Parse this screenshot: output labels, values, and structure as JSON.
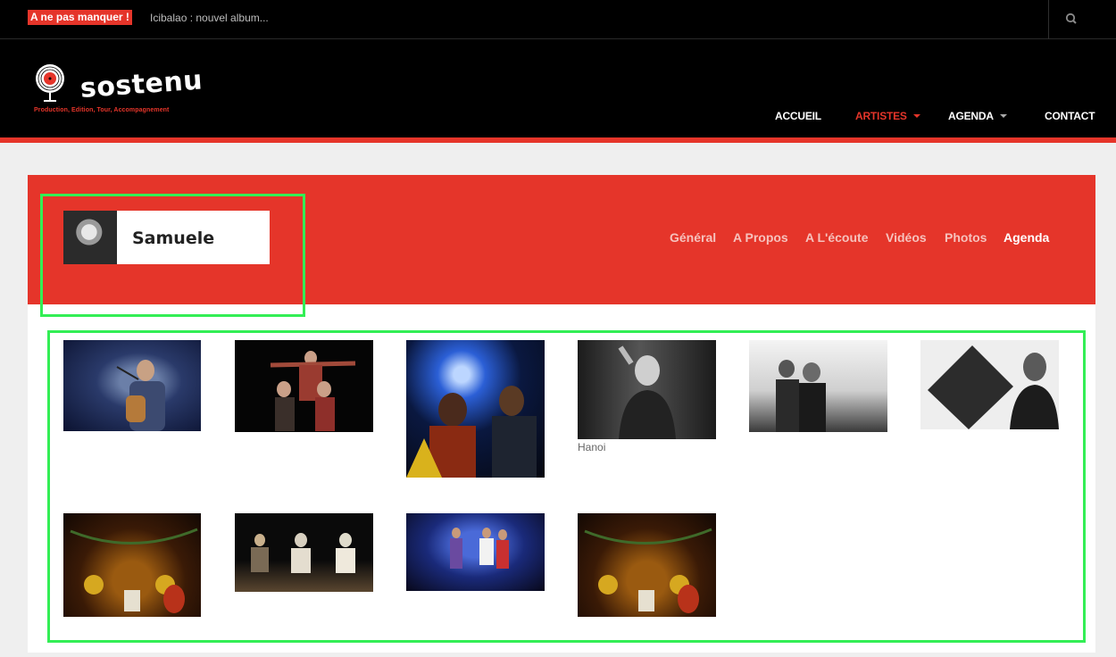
{
  "topbar": {
    "ticker_label": "A ne pas manquer !",
    "ticker_text": "Icibalao : nouvel album...",
    "search_icon": "search-icon"
  },
  "logo": {
    "wordmark": "sostenu",
    "tagline": "Production, Edition, Tour, Accompagnement"
  },
  "nav": {
    "items": [
      {
        "label": "ACCUEIL",
        "has_dropdown": false,
        "active": false
      },
      {
        "label": "ARTISTES",
        "has_dropdown": true,
        "active": true
      },
      {
        "label": "AGENDA",
        "has_dropdown": true,
        "active": false
      },
      {
        "label": "CONTACT",
        "has_dropdown": false,
        "active": false
      }
    ]
  },
  "artist": {
    "name": "Samuele",
    "tabs": [
      "Général",
      "A Propos",
      "A L'écoute",
      "Vidéos",
      "Photos",
      "Agenda"
    ],
    "active_tab": "Agenda"
  },
  "gallery": {
    "photos": [
      {
        "subject": "singer with guitar on stage"
      },
      {
        "subject": "group performing on dark stage"
      },
      {
        "subject": "concert with blue stage light"
      },
      {
        "subject": "black and white portrait",
        "caption": "Hanoi"
      },
      {
        "subject": "black and white duo portrait"
      },
      {
        "subject": "black and white band portrait"
      },
      {
        "subject": "theatre scene with lanterns"
      },
      {
        "subject": "three performers seated on stage"
      },
      {
        "subject": "band on colourful stage"
      },
      {
        "subject": "theatre scene with lanterns"
      }
    ]
  },
  "colors": {
    "accent": "#e5352a",
    "background": "#efefef",
    "header": "#000000",
    "highlight": "#33ee55"
  }
}
